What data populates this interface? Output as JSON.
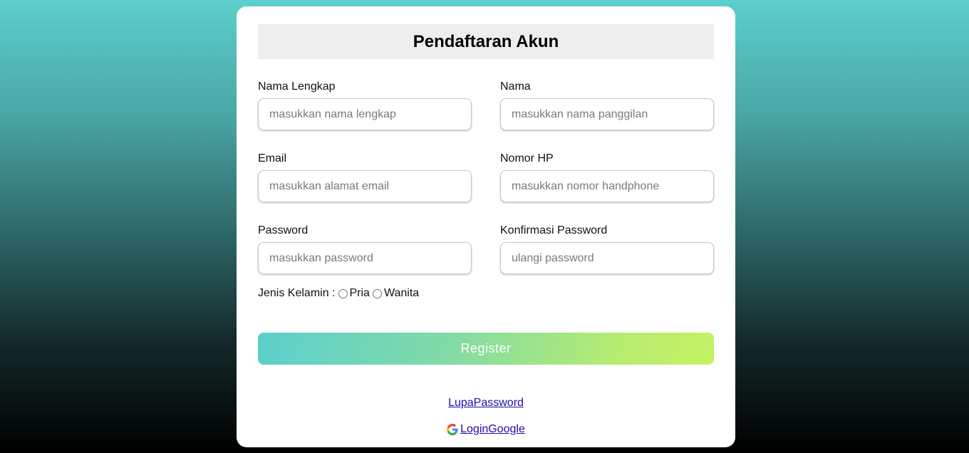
{
  "form": {
    "title": "Pendaftaran Akun",
    "fields": [
      {
        "label": "Nama Lengkap",
        "placeholder": "masukkan nama lengkap",
        "value": ""
      },
      {
        "label": "Nama",
        "placeholder": "masukkan nama panggilan",
        "value": ""
      },
      {
        "label": "Email",
        "placeholder": "masukkan alamat email",
        "value": ""
      },
      {
        "label": "Nomor HP",
        "placeholder": "masukkan nomor handphone",
        "value": ""
      },
      {
        "label": "Password",
        "placeholder": "masukkan password",
        "value": ""
      },
      {
        "label": "Konfirmasi Password",
        "placeholder": "ulangi password",
        "value": ""
      }
    ],
    "gender": {
      "label": "Jenis Kelamin :",
      "options": [
        "Pria",
        "Wanita"
      ],
      "selected": ""
    },
    "register_label": "Register",
    "forgot_password_link": "LupaPassword",
    "google_login_link": "LoginGoogle",
    "google_icon": "google-icon"
  },
  "colors": {
    "background_top": "#5ccfcc",
    "background_bottom": "#000000",
    "button_gradient_start": "#5ccfcc",
    "button_gradient_end": "#c5f263",
    "link": "#1a0dab"
  }
}
